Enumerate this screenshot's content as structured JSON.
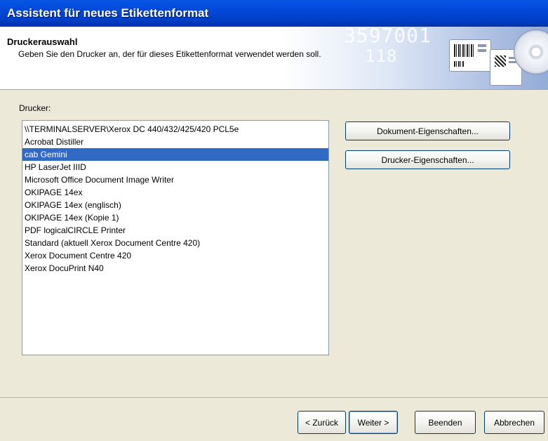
{
  "window": {
    "title": "Assistent für neues Etikettenformat"
  },
  "header": {
    "title": "Druckerauswahl",
    "subtitle": "Geben Sie den Drucker an, der für dieses Etikettenformat verwendet werden soll.",
    "deco_text": "3597001",
    "deco_text2": "118"
  },
  "printers": {
    "label": "Drucker:",
    "items": [
      "\\\\TERMINALSERVER\\Xerox DC 440/432/425/420 PCL5e",
      "Acrobat Distiller",
      "cab Gemini",
      "HP LaserJet IIID",
      "Microsoft Office Document Image Writer",
      "OKIPAGE 14ex",
      "OKIPAGE 14ex (englisch)",
      "OKIPAGE 14ex (Kopie 1)",
      "PDF logicalCIRCLE Printer",
      "Standard (aktuell Xerox Document Centre 420)",
      "Xerox Document Centre 420",
      "Xerox DocuPrint N40"
    ],
    "selected": "cab Gemini"
  },
  "buttons": {
    "document_properties": "Dokument-Eigenschaften...",
    "printer_properties": "Drucker-Eigenschaften...",
    "back": "< Zurück",
    "next": "Weiter >",
    "finish": "Beenden",
    "cancel": "Abbrechen"
  },
  "colors": {
    "title_bar": "#0046d5",
    "selection": "#316ac5",
    "dialog_bg": "#ece9d8"
  }
}
